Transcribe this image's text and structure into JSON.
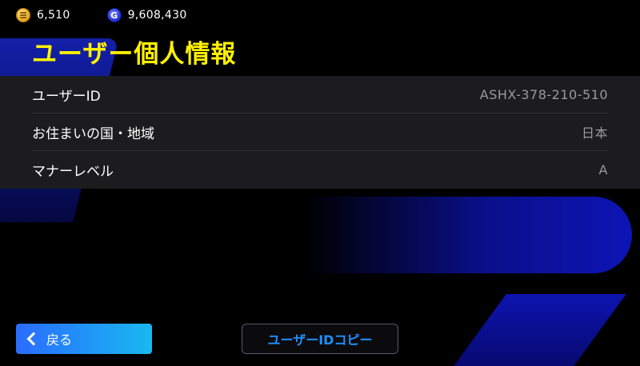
{
  "currencies": [
    {
      "icon": "gold-coin-icon",
      "value": "6,510"
    },
    {
      "icon": "gp-coin-icon",
      "glyph": "G",
      "value": "9,608,430"
    }
  ],
  "page_title": "ユーザー個人情報",
  "info_rows": [
    {
      "label": "ユーザーID",
      "value": "ASHX-378-210-510"
    },
    {
      "label": "お住まいの国・地域",
      "value": "日本"
    },
    {
      "label": "マナーレベル",
      "value": "A"
    }
  ],
  "footer": {
    "back_label": "戻る",
    "copy_label": "ユーザーIDコピー"
  },
  "colors": {
    "title": "#fff100",
    "accent_blue": "#1e90ff",
    "back_gradient_start": "#2a6cff",
    "back_gradient_end": "#19b8f0"
  }
}
